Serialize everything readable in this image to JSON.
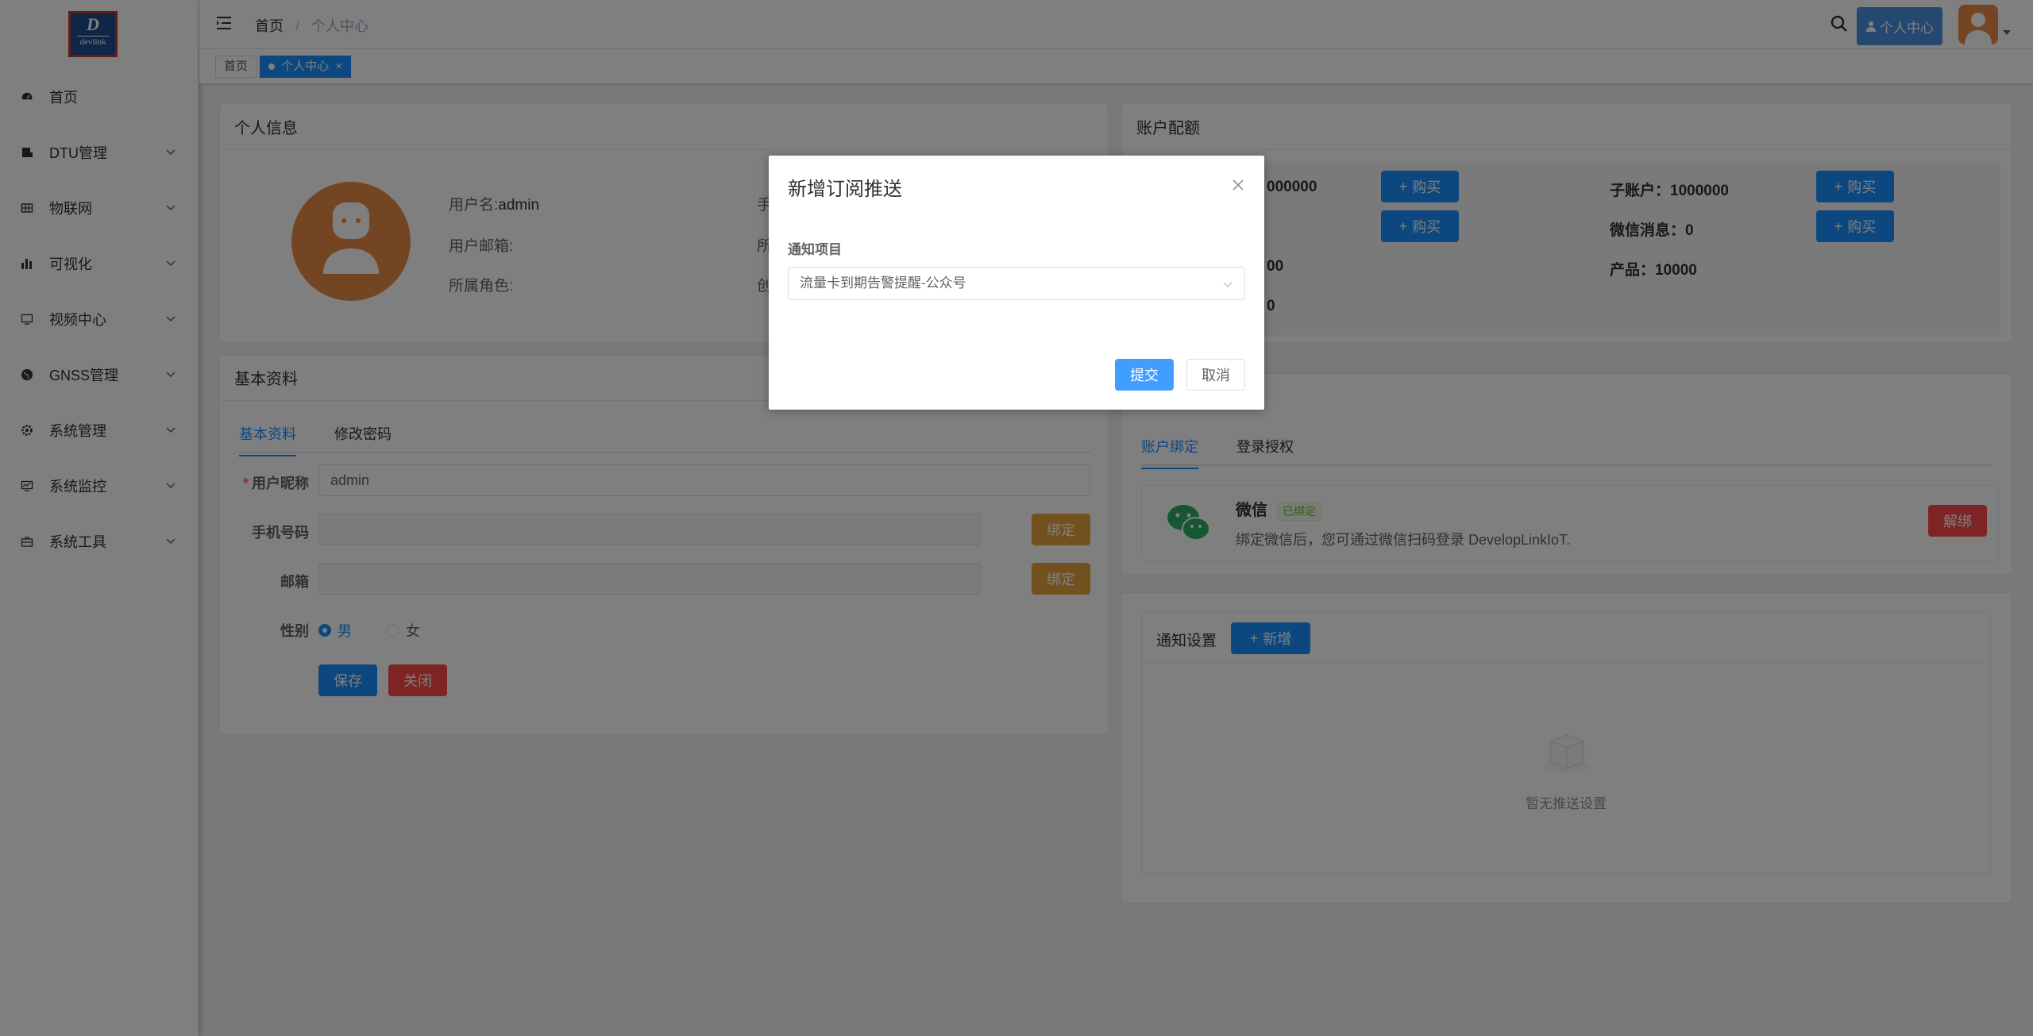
{
  "logo": {
    "letter": "D",
    "text": "devlink"
  },
  "sidebar": {
    "items": [
      {
        "label": "首页",
        "icon": "dashboard-icon",
        "has_children": false
      },
      {
        "label": "DTU管理",
        "icon": "server-icon",
        "has_children": true
      },
      {
        "label": "物联网",
        "icon": "grid-icon",
        "has_children": true
      },
      {
        "label": "可视化",
        "icon": "bar-chart-icon",
        "has_children": true
      },
      {
        "label": "视频中心",
        "icon": "monitor-icon",
        "has_children": true
      },
      {
        "label": "GNSS管理",
        "icon": "globe-icon",
        "has_children": true
      },
      {
        "label": "系统管理",
        "icon": "gear-icon",
        "has_children": true
      },
      {
        "label": "系统监控",
        "icon": "monitor-chart-icon",
        "has_children": true
      },
      {
        "label": "系统工具",
        "icon": "toolbox-icon",
        "has_children": true
      }
    ]
  },
  "navbar": {
    "breadcrumb_home": "首页",
    "breadcrumb_separator": "/",
    "breadcrumb_current": "个人中心",
    "user_button": "个人中心"
  },
  "tags": {
    "home": "首页",
    "current": "个人中心"
  },
  "profile": {
    "title": "个人信息",
    "username_label": "用户名:",
    "username_value": "admin",
    "email_label": "用户邮箱:",
    "role_label": "所属角色:",
    "phone_label_partial": "手",
    "dept_label_partial": "所",
    "created_label_partial": "创"
  },
  "basic": {
    "title": "基本资料",
    "tab_basic": "基本资料",
    "tab_password": "修改密码",
    "nickname_required": "*",
    "nickname_label": "用户昵称",
    "nickname_value": "admin",
    "phone_label": "手机号码",
    "email_label": "邮箱",
    "bind_label": "绑定",
    "gender_label": "性别",
    "gender_male": "男",
    "gender_female": "女",
    "save": "保存",
    "close": "关闭"
  },
  "quota": {
    "title": "账户配额",
    "row1_left_partial": "000000",
    "row3_left_partial": "00",
    "row4_left_partial": "0",
    "sub_account": "子账户：1000000",
    "wechat_msg": "微信消息：0",
    "product": "产品：10000",
    "buy_label": "购买"
  },
  "binding": {
    "tab_account": "账户绑定",
    "tab_login": "登录授权",
    "wechat_name": "微信",
    "bound_badge": "已绑定",
    "wechat_desc": "绑定微信后，您可通过微信扫码登录 DevelopLinkIoT.",
    "unbind": "解绑"
  },
  "notify": {
    "title": "通知设置",
    "add": "新增",
    "empty_text": "暂无推送设置"
  },
  "dialog": {
    "title": "新增订阅推送",
    "field_label": "通知项目",
    "selected_value": "流量卡到期告警提醒-公众号",
    "submit": "提交",
    "cancel": "取消"
  }
}
